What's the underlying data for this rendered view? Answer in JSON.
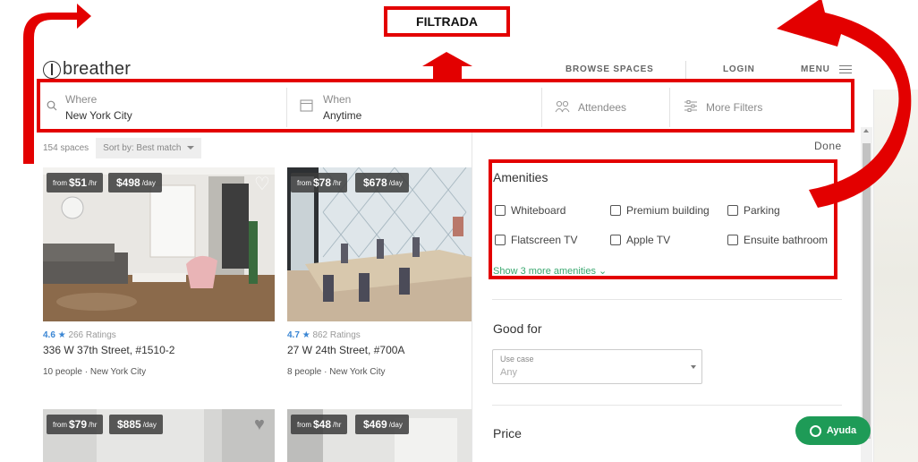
{
  "annotation": {
    "label": "FILTRADA",
    "color": "#e30000"
  },
  "header": {
    "logo_text": "breather",
    "nav": {
      "browse": "BROWSE SPACES",
      "login": "LOGIN",
      "menu": "MENU"
    }
  },
  "search": {
    "where_label": "Where",
    "where_value": "New York City",
    "when_label": "When",
    "when_value": "Anytime",
    "attendees": "Attendees",
    "more_filters": "More Filters"
  },
  "list": {
    "count": "154 spaces",
    "sort_label": "Sort by:",
    "sort_value": "Best match",
    "cards": [
      {
        "from": "from",
        "hourly": "$51",
        "hr": "/hr",
        "daily": "$498",
        "day": "/day",
        "rating": "4.6",
        "ratings_count": "266 Ratings",
        "address": "336 W 37th Street, #1510-2",
        "people": "10 people",
        "sep": "·",
        "city": "New York City"
      },
      {
        "from": "from",
        "hourly": "$78",
        "hr": "/hr",
        "daily": "$678",
        "day": "/day",
        "rating": "4.7",
        "ratings_count": "862 Ratings",
        "address": "27 W 24th Street, #700A",
        "people": "8 people",
        "sep": "·",
        "city": "New York City"
      },
      {
        "from": "from",
        "hourly": "$79",
        "hr": "/hr",
        "daily": "$885",
        "day": "/day"
      },
      {
        "from": "from",
        "hourly": "$48",
        "hr": "/hr",
        "daily": "$469",
        "day": "/day"
      }
    ]
  },
  "filters": {
    "done": "Done",
    "amenities_title": "Amenities",
    "amenities": [
      "Whiteboard",
      "Premium building",
      "Parking",
      "Flatscreen TV",
      "Apple TV",
      "Ensuite bathroom"
    ],
    "show_more": "Show 3 more amenities",
    "good_for_title": "Good for",
    "use_case_label": "Use case",
    "use_case_value": "Any",
    "price_title": "Price"
  },
  "help": {
    "label": "Ayuda"
  },
  "colors": {
    "accent_green": "#3aa870",
    "rating_blue": "#3a86d4",
    "help_green": "#1e9b57"
  }
}
